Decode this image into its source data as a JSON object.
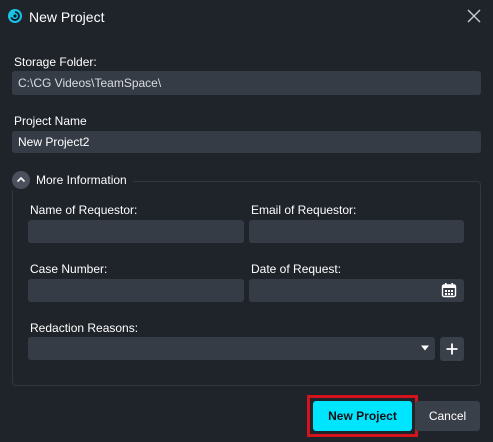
{
  "dialog": {
    "title": "New Project"
  },
  "storage": {
    "label": "Storage Folder:",
    "value": "C:\\CG Videos\\TeamSpace\\"
  },
  "project_name": {
    "label": "Project Name",
    "value": "New Project2"
  },
  "more_info": {
    "label": "More Information",
    "expanded": true,
    "requestor_name": {
      "label": "Name of Requestor:",
      "value": ""
    },
    "requestor_email": {
      "label": "Email of Requestor:",
      "value": ""
    },
    "case_number": {
      "label": "Case Number:",
      "value": ""
    },
    "request_date": {
      "label": "Date of Request:",
      "value": ""
    },
    "redaction_reasons": {
      "label": "Redaction Reasons:",
      "value": ""
    }
  },
  "buttons": {
    "new_project": "New Project",
    "cancel": "Cancel"
  },
  "icons": {
    "logo": "app-logo-icon",
    "close": "close-icon",
    "collapse": "chevron-up-icon",
    "calendar": "calendar-icon",
    "dropdown": "caret-down-icon",
    "add": "plus-icon"
  },
  "colors": {
    "background": "#1f232a",
    "field": "#363c46",
    "accent": "#00e5ff",
    "highlight": "#d4141c"
  }
}
